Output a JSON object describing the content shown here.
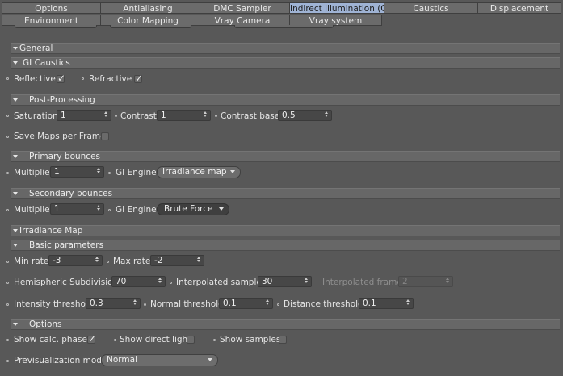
{
  "tabs_row1": [
    "Options",
    "Antialiasing",
    "DMC Sampler",
    "Indirect illumination (GI)",
    "Caustics",
    "Displacement"
  ],
  "tabs_row2": [
    "Environment",
    "Color Mapping",
    "Vray Camera",
    "Vray system"
  ],
  "active_tab": "Indirect illumination (GI)",
  "sections": {
    "general": "General",
    "gi_caustics": "GI Caustics",
    "post_processing": "Post-Processing",
    "primary_bounces": "Primary bounces",
    "secondary_bounces": "Secondary bounces",
    "irradiance_map": "Irradiance Map",
    "basic_parameters": "Basic parameters",
    "options": "Options"
  },
  "gi_caustics": {
    "reflective_label": "Reflective",
    "reflective_checked": true,
    "refractive_label": "Refractive",
    "refractive_checked": true
  },
  "post_processing": {
    "saturation_label": "Saturation",
    "saturation_value": "1",
    "contrast_label": "Contrast",
    "contrast_value": "1",
    "contrast_base_label": "Contrast base",
    "contrast_base_value": "0.5",
    "save_maps_label": "Save Maps per Frame",
    "save_maps_checked": false
  },
  "primary": {
    "multiplier_label": "Multiplier",
    "multiplier_value": "1",
    "engine_label": "GI Engine",
    "engine_value": "Irradiance map"
  },
  "secondary": {
    "multiplier_label": "Multiplier",
    "multiplier_value": "1",
    "engine_label": "GI Engine",
    "engine_value": "Brute Force"
  },
  "basic": {
    "min_rate_label": "Min rate",
    "min_rate_value": "-3",
    "max_rate_label": "Max rate",
    "max_rate_value": "-2",
    "hemi_label": "Hemispheric Subdivision",
    "hemi_value": "70",
    "interp_label": "Interpolated samples",
    "interp_value": "30",
    "interp_frames_label": "Interpolated frames",
    "interp_frames_value": "2",
    "intensity_label": "Intensity threshold",
    "intensity_value": "0.3",
    "normal_label": "Normal threshold",
    "normal_value": "0.1",
    "distance_label": "Distance threshold",
    "distance_value": "0.1"
  },
  "options": {
    "calc_phase_label": "Show calc. phase",
    "calc_phase_checked": true,
    "direct_light_label": "Show direct light",
    "direct_light_checked": false,
    "samples_label": "Show samples",
    "samples_checked": false,
    "preview_label": "Previsualization mode",
    "preview_value": "Normal"
  },
  "colors": {
    "background": "#585858",
    "active_tab": "#9fb3d4",
    "section_bar": "#676767"
  }
}
